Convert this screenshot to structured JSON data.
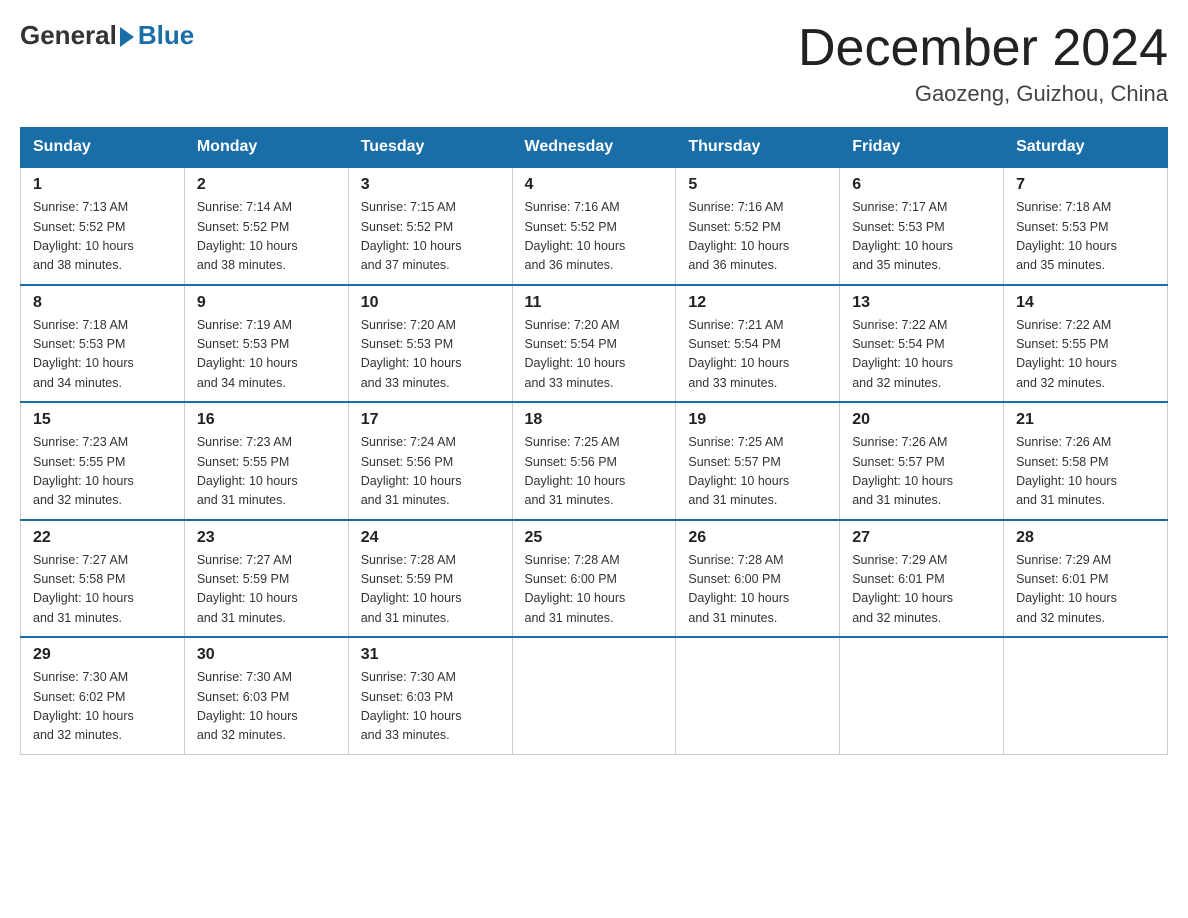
{
  "logo": {
    "general": "General",
    "blue": "Blue"
  },
  "title": "December 2024",
  "location": "Gaozeng, Guizhou, China",
  "days_of_week": [
    "Sunday",
    "Monday",
    "Tuesday",
    "Wednesday",
    "Thursday",
    "Friday",
    "Saturday"
  ],
  "weeks": [
    [
      {
        "day": 1,
        "sunrise": "7:13 AM",
        "sunset": "5:52 PM",
        "daylight": "10 hours and 38 minutes."
      },
      {
        "day": 2,
        "sunrise": "7:14 AM",
        "sunset": "5:52 PM",
        "daylight": "10 hours and 38 minutes."
      },
      {
        "day": 3,
        "sunrise": "7:15 AM",
        "sunset": "5:52 PM",
        "daylight": "10 hours and 37 minutes."
      },
      {
        "day": 4,
        "sunrise": "7:16 AM",
        "sunset": "5:52 PM",
        "daylight": "10 hours and 36 minutes."
      },
      {
        "day": 5,
        "sunrise": "7:16 AM",
        "sunset": "5:52 PM",
        "daylight": "10 hours and 36 minutes."
      },
      {
        "day": 6,
        "sunrise": "7:17 AM",
        "sunset": "5:53 PM",
        "daylight": "10 hours and 35 minutes."
      },
      {
        "day": 7,
        "sunrise": "7:18 AM",
        "sunset": "5:53 PM",
        "daylight": "10 hours and 35 minutes."
      }
    ],
    [
      {
        "day": 8,
        "sunrise": "7:18 AM",
        "sunset": "5:53 PM",
        "daylight": "10 hours and 34 minutes."
      },
      {
        "day": 9,
        "sunrise": "7:19 AM",
        "sunset": "5:53 PM",
        "daylight": "10 hours and 34 minutes."
      },
      {
        "day": 10,
        "sunrise": "7:20 AM",
        "sunset": "5:53 PM",
        "daylight": "10 hours and 33 minutes."
      },
      {
        "day": 11,
        "sunrise": "7:20 AM",
        "sunset": "5:54 PM",
        "daylight": "10 hours and 33 minutes."
      },
      {
        "day": 12,
        "sunrise": "7:21 AM",
        "sunset": "5:54 PM",
        "daylight": "10 hours and 33 minutes."
      },
      {
        "day": 13,
        "sunrise": "7:22 AM",
        "sunset": "5:54 PM",
        "daylight": "10 hours and 32 minutes."
      },
      {
        "day": 14,
        "sunrise": "7:22 AM",
        "sunset": "5:55 PM",
        "daylight": "10 hours and 32 minutes."
      }
    ],
    [
      {
        "day": 15,
        "sunrise": "7:23 AM",
        "sunset": "5:55 PM",
        "daylight": "10 hours and 32 minutes."
      },
      {
        "day": 16,
        "sunrise": "7:23 AM",
        "sunset": "5:55 PM",
        "daylight": "10 hours and 31 minutes."
      },
      {
        "day": 17,
        "sunrise": "7:24 AM",
        "sunset": "5:56 PM",
        "daylight": "10 hours and 31 minutes."
      },
      {
        "day": 18,
        "sunrise": "7:25 AM",
        "sunset": "5:56 PM",
        "daylight": "10 hours and 31 minutes."
      },
      {
        "day": 19,
        "sunrise": "7:25 AM",
        "sunset": "5:57 PM",
        "daylight": "10 hours and 31 minutes."
      },
      {
        "day": 20,
        "sunrise": "7:26 AM",
        "sunset": "5:57 PM",
        "daylight": "10 hours and 31 minutes."
      },
      {
        "day": 21,
        "sunrise": "7:26 AM",
        "sunset": "5:58 PM",
        "daylight": "10 hours and 31 minutes."
      }
    ],
    [
      {
        "day": 22,
        "sunrise": "7:27 AM",
        "sunset": "5:58 PM",
        "daylight": "10 hours and 31 minutes."
      },
      {
        "day": 23,
        "sunrise": "7:27 AM",
        "sunset": "5:59 PM",
        "daylight": "10 hours and 31 minutes."
      },
      {
        "day": 24,
        "sunrise": "7:28 AM",
        "sunset": "5:59 PM",
        "daylight": "10 hours and 31 minutes."
      },
      {
        "day": 25,
        "sunrise": "7:28 AM",
        "sunset": "6:00 PM",
        "daylight": "10 hours and 31 minutes."
      },
      {
        "day": 26,
        "sunrise": "7:28 AM",
        "sunset": "6:00 PM",
        "daylight": "10 hours and 31 minutes."
      },
      {
        "day": 27,
        "sunrise": "7:29 AM",
        "sunset": "6:01 PM",
        "daylight": "10 hours and 32 minutes."
      },
      {
        "day": 28,
        "sunrise": "7:29 AM",
        "sunset": "6:01 PM",
        "daylight": "10 hours and 32 minutes."
      }
    ],
    [
      {
        "day": 29,
        "sunrise": "7:30 AM",
        "sunset": "6:02 PM",
        "daylight": "10 hours and 32 minutes."
      },
      {
        "day": 30,
        "sunrise": "7:30 AM",
        "sunset": "6:03 PM",
        "daylight": "10 hours and 32 minutes."
      },
      {
        "day": 31,
        "sunrise": "7:30 AM",
        "sunset": "6:03 PM",
        "daylight": "10 hours and 33 minutes."
      },
      null,
      null,
      null,
      null
    ]
  ],
  "labels": {
    "sunrise": "Sunrise:",
    "sunset": "Sunset:",
    "daylight": "Daylight:"
  }
}
